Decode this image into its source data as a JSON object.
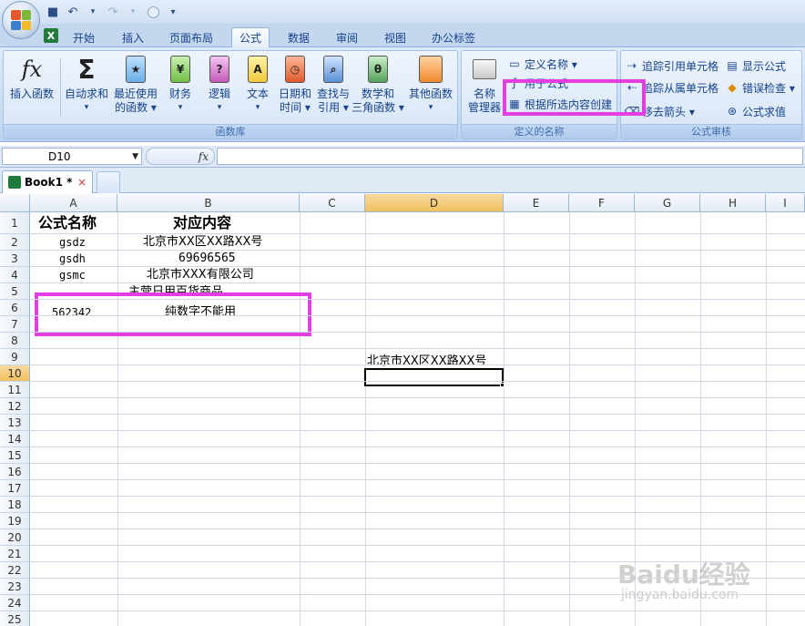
{
  "quick_access": {
    "icons": [
      "save-icon",
      "undo-icon",
      "redo-icon",
      "circle-icon",
      "customize-icon"
    ]
  },
  "tabs": [
    "开始",
    "插入",
    "页面布局",
    "公式",
    "数据",
    "审阅",
    "视图",
    "办公标签"
  ],
  "active_tab": "公式",
  "ribbon": {
    "function_library": {
      "label": "函数库",
      "buttons": [
        {
          "line1": "插入函数",
          "line2": ""
        },
        {
          "line1": "自动求和",
          "line2": "▾"
        },
        {
          "line1": "最近使用",
          "line2": "的函数 ▾"
        },
        {
          "line1": "财务",
          "line2": "▾"
        },
        {
          "line1": "逻辑",
          "line2": "▾"
        },
        {
          "line1": "文本",
          "line2": "▾"
        },
        {
          "line1": "日期和",
          "line2": "时间 ▾"
        },
        {
          "line1": "查找与",
          "line2": "引用 ▾"
        },
        {
          "line1": "数学和",
          "line2": "三角函数 ▾"
        },
        {
          "line1": "其他函数",
          "line2": "▾"
        }
      ]
    },
    "defined_names": {
      "label": "定义的名称",
      "name_manager_line1": "名称",
      "name_manager_line2": "管理器",
      "define_name": "定义名称 ▾",
      "use_in_formula": "用于公式",
      "create_from_selection": "根据所选内容创建"
    },
    "formula_auditing": {
      "label": "公式审核",
      "trace_precedents": "追踪引用单元格",
      "trace_dependents": "追踪从属单元格",
      "remove_arrows": "移去箭头 ▾",
      "show_formulas": "显示公式",
      "error_checking": "错误检查 ▾",
      "evaluate_formula": "公式求值"
    }
  },
  "formula_bar": {
    "name_box": "D10",
    "fx": "fx",
    "formula": ""
  },
  "workbook_tab": {
    "title": "Book1 *",
    "close": "×"
  },
  "sheet": {
    "columns": [
      "A",
      "B",
      "C",
      "D",
      "E",
      "F",
      "G",
      "H",
      "I"
    ],
    "selected_column": "D",
    "selected_row": "10",
    "rows": [
      "1",
      "2",
      "3",
      "4",
      "5",
      "6",
      "7",
      "8",
      "9",
      "10",
      "11",
      "12",
      "13",
      "14",
      "15",
      "16",
      "17",
      "18",
      "19",
      "20",
      "21",
      "22",
      "23",
      "24",
      "25"
    ],
    "cells": {
      "A1": "公式名称",
      "B1": "对应内容",
      "A2": "gsdz",
      "B2": "北京市XX区XX路XX号",
      "A3": "gsdh",
      "B3": "69696565",
      "A4": "gsmc",
      "B4": "北京市XXX有限公司",
      "B5": "主营日用百货商品",
      "A6": "562342",
      "B6": "纯数字不能用",
      "D9": "北京市XX区XX路XX号"
    }
  },
  "watermark": {
    "brand": "Baidu经验",
    "url": "jingyan.baidu.com"
  }
}
